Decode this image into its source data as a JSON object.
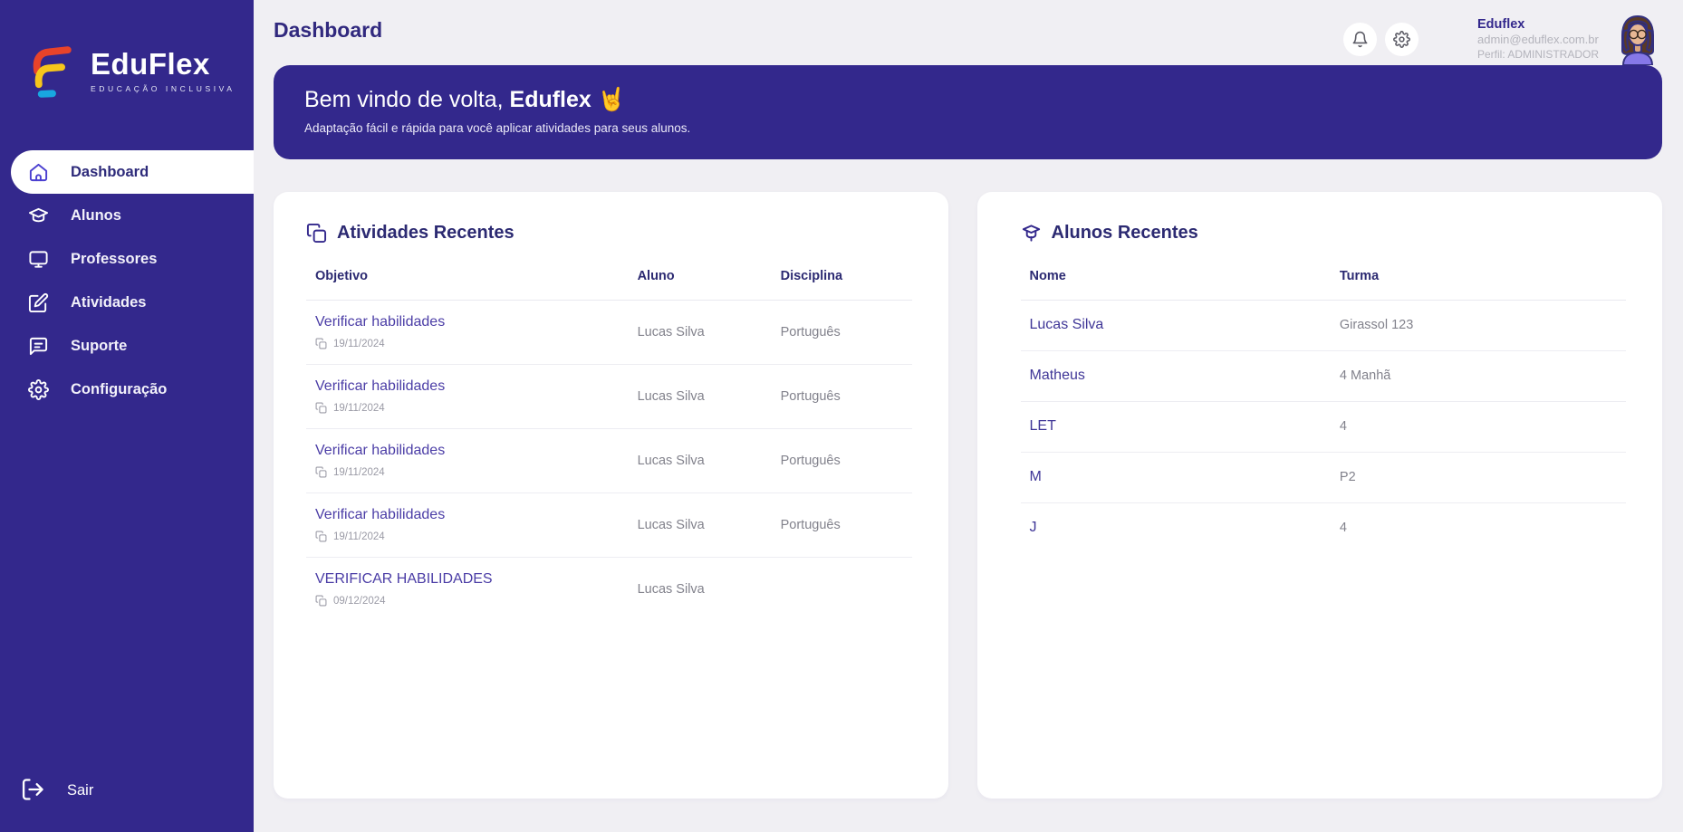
{
  "app": {
    "brand": "EduFlex",
    "tagline": "EDUCAÇÃO INCLUSIVA"
  },
  "colors": {
    "brand_indigo": "#33288c",
    "active_text": "#2d2a7a",
    "link_purple": "#4b3da6",
    "muted_gray": "#82828c",
    "background": "#f0eff3",
    "logo_red": "#e8432a",
    "logo_yellow": "#f6c61c",
    "logo_blue": "#18a7e0"
  },
  "sidebar": {
    "items": [
      {
        "label": "Dashboard",
        "icon": "home-icon",
        "active": true
      },
      {
        "label": "Alunos",
        "icon": "graduation-icon",
        "active": false
      },
      {
        "label": "Professores",
        "icon": "monitor-icon",
        "active": false
      },
      {
        "label": "Atividades",
        "icon": "edit-icon",
        "active": false
      },
      {
        "label": "Suporte",
        "icon": "chat-icon",
        "active": false
      },
      {
        "label": "Configuração",
        "icon": "gear-icon",
        "active": false
      }
    ],
    "logout_label": "Sair"
  },
  "header": {
    "title": "Dashboard",
    "user": {
      "name": "Eduflex",
      "email": "admin@eduflex.com.br",
      "profile": "Perfil: ADMINISTRADOR"
    }
  },
  "banner": {
    "greeting_prefix": "Bem vindo de volta, ",
    "greeting_name": "Eduflex",
    "greeting_emoji": "🤘",
    "subtitle": "Adaptação fácil e rápida para você aplicar atividades para seus alunos."
  },
  "activities_card": {
    "title": "Atividades Recentes",
    "columns": {
      "objective": "Objetivo",
      "student": "Aluno",
      "subject": "Disciplina"
    },
    "rows": [
      {
        "objective": "Verificar habilidades",
        "date": "19/11/2024",
        "student": "Lucas Silva",
        "subject": "Português"
      },
      {
        "objective": "Verificar habilidades",
        "date": "19/11/2024",
        "student": "Lucas Silva",
        "subject": "Português"
      },
      {
        "objective": "Verificar habilidades",
        "date": "19/11/2024",
        "student": "Lucas Silva",
        "subject": "Português"
      },
      {
        "objective": "Verificar habilidades",
        "date": "19/11/2024",
        "student": "Lucas Silva",
        "subject": "Português"
      },
      {
        "objective": "VERIFICAR HABILIDADES",
        "date": "09/12/2024",
        "student": "Lucas Silva",
        "subject": ""
      }
    ]
  },
  "students_card": {
    "title": "Alunos Recentes",
    "columns": {
      "name": "Nome",
      "class": "Turma"
    },
    "rows": [
      {
        "name": "Lucas Silva",
        "class": "Girassol 123"
      },
      {
        "name": "Matheus",
        "class": "4 Manhã"
      },
      {
        "name": "LET",
        "class": "4"
      },
      {
        "name": "M",
        "class": "P2"
      },
      {
        "name": "J",
        "class": "4"
      }
    ]
  }
}
